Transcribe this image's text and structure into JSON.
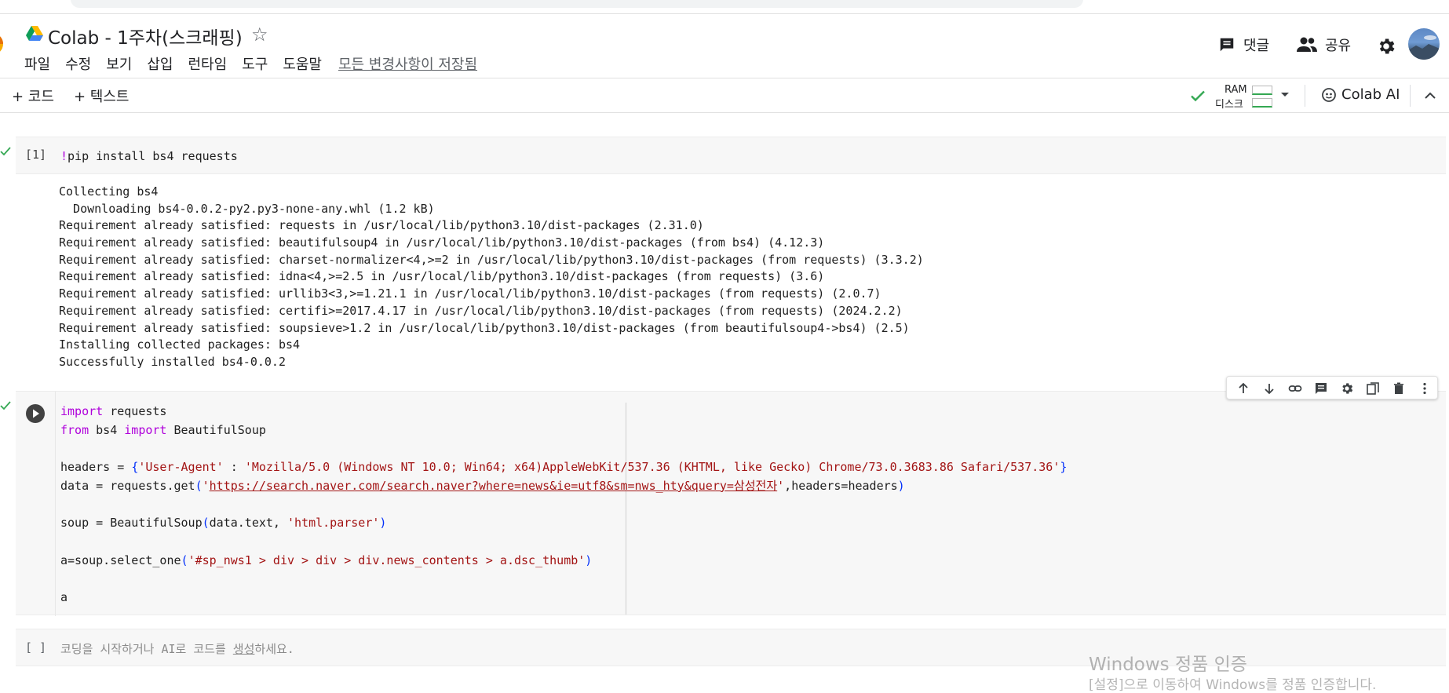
{
  "notebook": {
    "title": "Colab - 1주차(스크래핑)"
  },
  "menu": {
    "items": [
      "파일",
      "수정",
      "보기",
      "삽입",
      "런타임",
      "도구",
      "도움말"
    ],
    "save_status": "모든 변경사항이 저장됨"
  },
  "header_actions": {
    "comment_label": "댓글",
    "share_label": "공유"
  },
  "toolbar": {
    "add_code_label": "+ 코드",
    "add_text_label": "+ 텍스트",
    "ram_label": "RAM",
    "disk_label": "디스크",
    "colab_ai_label": "Colab AI"
  },
  "cells": {
    "cell1": {
      "exec_count": "[1]",
      "bang": "!",
      "code": "pip install bs4 requests",
      "output": [
        "Collecting bs4",
        "  Downloading bs4-0.0.2-py2.py3-none-any.whl (1.2 kB)",
        "Requirement already satisfied: requests in /usr/local/lib/python3.10/dist-packages (2.31.0)",
        "Requirement already satisfied: beautifulsoup4 in /usr/local/lib/python3.10/dist-packages (from bs4) (4.12.3)",
        "Requirement already satisfied: charset-normalizer<4,>=2 in /usr/local/lib/python3.10/dist-packages (from requests) (3.3.2)",
        "Requirement already satisfied: idna<4,>=2.5 in /usr/local/lib/python3.10/dist-packages (from requests) (3.6)",
        "Requirement already satisfied: urllib3<3,>=1.21.1 in /usr/local/lib/python3.10/dist-packages (from requests) (2.0.7)",
        "Requirement already satisfied: certifi>=2017.4.17 in /usr/local/lib/python3.10/dist-packages (from requests) (2024.2.2)",
        "Requirement already satisfied: soupsieve>1.2 in /usr/local/lib/python3.10/dist-packages (from beautifulsoup4->bs4) (2.5)",
        "Installing collected packages: bs4",
        "Successfully installed bs4-0.0.2"
      ]
    },
    "cell2": {
      "kw_import": "import",
      "kw_from": "from",
      "l1_rest": " requests",
      "l2_mod": " bs4 ",
      "l2_rest": " BeautifulSoup",
      "l4_pre": "headers = ",
      "l4_open": "{",
      "l4_str1": "'User-Agent'",
      "l4_mid": " : ",
      "l4_str2": "'Mozilla/5.0 (Windows NT 10.0; Win64; x64)AppleWebKit/537.36 (KHTML, like Gecko) Chrome/73.0.3683.86 Safari/537.36'",
      "l4_close": "}",
      "l5_pre": "data = requests.get",
      "l5_open": "(",
      "l5_q1": "'",
      "l5_url": "https://search.naver.com/search.naver?where=news&ie=utf8&sm=nws_hty&query=삼성전자",
      "l5_q2": "'",
      "l5_rest": ",headers=headers",
      "l5_close": ")",
      "l7_pre": "soup = BeautifulSoup",
      "l7_open": "(",
      "l7_mid": "data.text, ",
      "l7_str": "'html.parser'",
      "l7_close": ")",
      "l9_pre": "a=soup.select_one",
      "l9_open": "(",
      "l9_str": "'#sp_nws1 > div > div > div.news_contents > a.dsc_thumb'",
      "l9_close": ")",
      "l11": "a"
    },
    "cell3": {
      "exec_count": "[ ]",
      "placeholder_pre": "코딩을 시작하거나 AI로 코드를 ",
      "placeholder_link": "생성",
      "placeholder_post": "하세요."
    }
  },
  "watermark": {
    "line1": "Windows 정품 인증",
    "line2": "[설정]으로 이동하여 Windows를 정품 인증합니다."
  },
  "colors": {
    "keyword": "#af00db",
    "string": "#a31515",
    "bracket": "#0431fa",
    "success": "#34a853",
    "icon": "#3c4043"
  }
}
